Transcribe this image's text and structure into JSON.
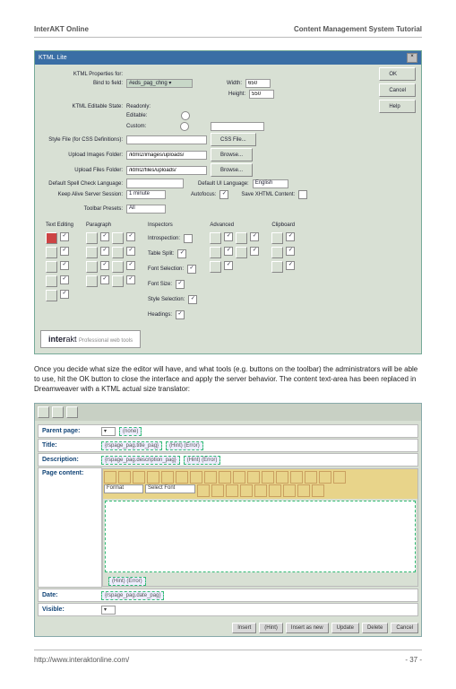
{
  "header": {
    "left": "InterAKT Online",
    "right": "Content Management System Tutorial"
  },
  "footer": {
    "left": "http://www.interaktonline.com/",
    "right": "- 37 -"
  },
  "dlg": {
    "title": "KTML Lite",
    "props": "KTML Properties for:",
    "bind": "Bind to field:",
    "bindsel": "#eds_pag_chng ▾",
    "width": "Width:",
    "widthv": "650",
    "height": "Height:",
    "heightv": "550",
    "editable": "KTML Editable State:",
    "r1": "Readonly:",
    "r2": "Editable:",
    "r3": "Custom:",
    "style": "Style File (for CSS Definitions):",
    "stylebtn": "CSS File...",
    "upimg": "Upload Images Folder:",
    "upimgv": "/ktml2/images/uploads/",
    "upfile": "Upload Files Folder:",
    "upfilev": "/ktml2/files/uploads/",
    "browse": "Browse...",
    "spell": "Default Spell Check Language:",
    "uilang": "Default UI Language:",
    "uilangv": "English",
    "keepalive": "Keep Alive Server Session:",
    "keepv": "1 minute",
    "autofocus": "Autofocus:",
    "save": "Save XHTML Content:",
    "toolbar": "Toolbar Presets:",
    "toolbarv": "All",
    "ok": "OK",
    "cancel": "Cancel",
    "help": "Help",
    "cols": [
      "Text Editing",
      "Paragraph",
      "Inspectors",
      "Advanced",
      "Clipboard"
    ],
    "insp": [
      "Introspection:",
      "Table Split:",
      "Font Selection:",
      "Font Size:",
      "Style Selection:",
      "Headings:"
    ],
    "logo1": "inter",
    "logo2": "akt",
    "logo3": "Professional web tools"
  },
  "para": "Once you decide what size the editor will have, and what tools (e.g. buttons on the toolbar) the administrators will be able to use, hit the OK button to close the interface and apply the server behavior. The content text-area has been replaced in Dreamweaver with a KTML actual size translator:",
  "s2": {
    "parent": "Parent page:",
    "parentv": "(none)",
    "title": "Title:",
    "titlev": "{rspage_pag.title_pag}",
    "hint": "(Hint) (Error)",
    "desc": "Description:",
    "descv": "{rspage_pag.description_pag}",
    "pcontent": "Page content:",
    "format": "Format",
    "font": "Select Font",
    "small": "(Hint) (Error)",
    "date": "Date:",
    "datev": "{rspage_pag.date_pag}",
    "visible": "Visible:",
    "btns": [
      "Insert",
      "(Hint)",
      "Insert as new",
      "Update",
      "Delete",
      "Cancel"
    ]
  }
}
